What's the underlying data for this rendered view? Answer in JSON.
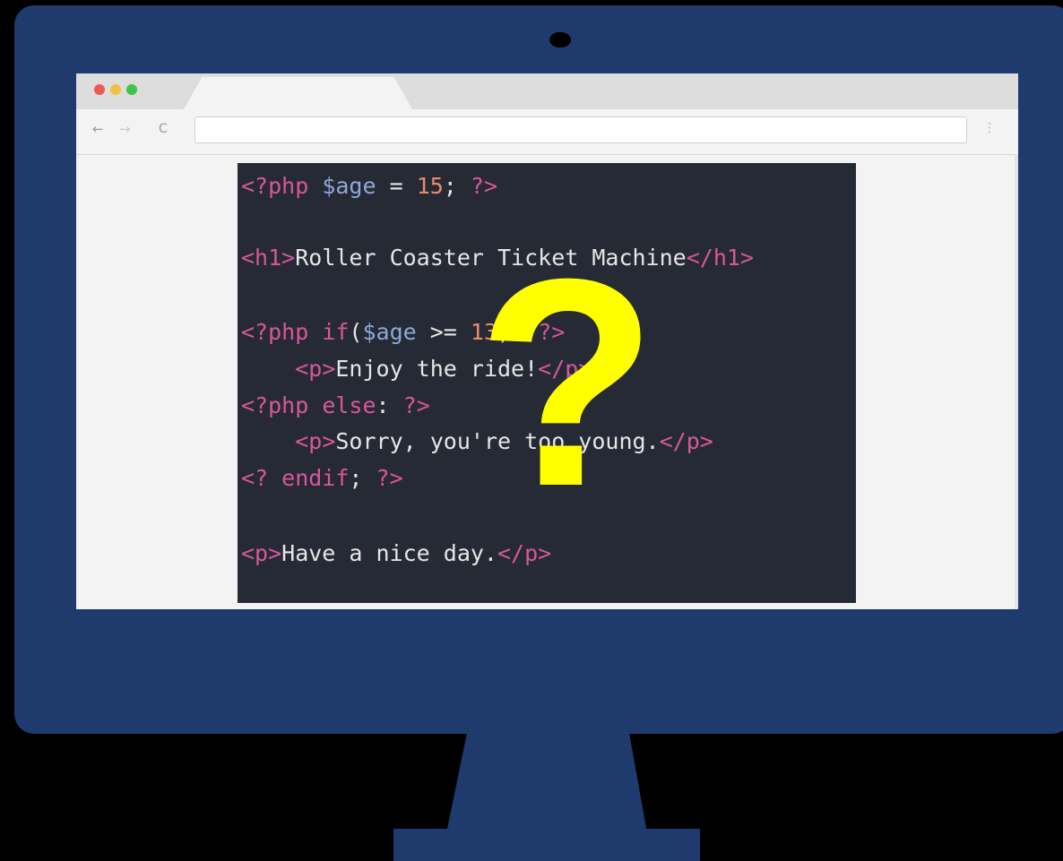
{
  "browser": {
    "traffic_lights": [
      {
        "name": "close",
        "color": "#ee5a52"
      },
      {
        "name": "minimize",
        "color": "#f4bf3e"
      },
      {
        "name": "zoom",
        "color": "#3ec645"
      }
    ],
    "nav": {
      "back_glyph": "←",
      "forward_glyph": "→",
      "reload_glyph": "C",
      "menu_glyph": "⋮"
    },
    "address": {
      "value": "",
      "placeholder": ""
    }
  },
  "code": {
    "line1": {
      "open": "<?php ",
      "var": "$age",
      "op": " = ",
      "num": "15",
      "semi": ";",
      "close": " ?>"
    },
    "line2": {
      "open_tag": "<h1>",
      "text": "Roller Coaster Ticket Machine",
      "close_tag": "</h1>"
    },
    "line3": {
      "php": "<?php ",
      "kw": "if",
      "paren_open": "(",
      "var": "$age",
      "op": " >= ",
      "num": "13",
      "paren_close": "):",
      "close": " ?>"
    },
    "line4": {
      "indent": "    ",
      "open_tag": "<p>",
      "text": "Enjoy the ride!",
      "close_tag": "</p>"
    },
    "line5": {
      "php": "<?php ",
      "kw": "else",
      "colon": ":",
      "close": " ?>"
    },
    "line6": {
      "indent": "    ",
      "open_tag": "<p>",
      "text": "Sorry, you're too young.",
      "close_tag": "</p>"
    },
    "line7": {
      "php": "<? ",
      "kw": "endif",
      "semi": ";",
      "close": " ?>"
    },
    "line8": {
      "open_tag": "<p>",
      "text": "Have a nice day.",
      "close_tag": "</p>"
    }
  },
  "overlay": {
    "symbol": "?",
    "color": "#ffff00"
  },
  "colors": {
    "background": "#000000",
    "monitor": "#1f3b6d",
    "code_background": "#262a35",
    "keyword": "#d9569b",
    "variable": "#8fa8d9",
    "number": "#ec8a6a",
    "text": "#e6e6e6"
  }
}
